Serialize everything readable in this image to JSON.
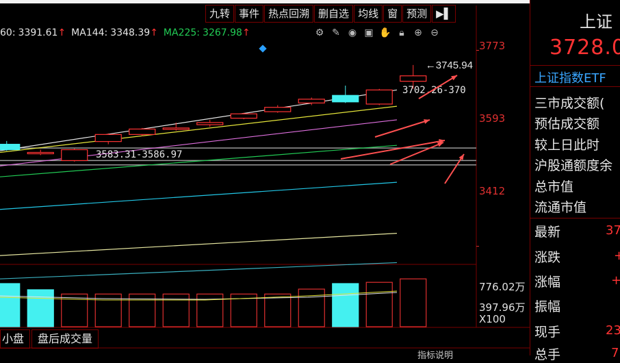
{
  "toolbar": {
    "items": [
      "九转",
      "事件",
      "热点回溯",
      "删自选",
      "均线",
      "窗",
      "预测",
      "▶▌"
    ]
  },
  "ma_legend": [
    {
      "label": "60:",
      "value": "3391.61",
      "arrow": "↑",
      "color": "#e6e6e6"
    },
    {
      "label": "MA144:",
      "value": "3348.39",
      "arrow": "↑",
      "color": "#e6e6e6"
    },
    {
      "label": "MA225:",
      "value": "3267.98",
      "arrow": "↑",
      "color": "#22cc55"
    }
  ],
  "toolbar_icons": [
    "gear-icon",
    "pen-icon",
    "eye-icon",
    "bag-icon",
    "hand-icon",
    "lock-icon",
    "zoom-in-icon",
    "zoom-out-icon"
  ],
  "price_axis": {
    "labels": [
      "3773",
      "3593",
      "3412"
    ],
    "color": "#e03030"
  },
  "volume_axis": {
    "labels": [
      "776.02万",
      "397.96万",
      "X100"
    ]
  },
  "annotations": {
    "high": "3745.94",
    "current_range": "3702.26-370",
    "gap_range": "3583.31-3586.97"
  },
  "bottom_tabs": [
    "小盘",
    "盘后成交量"
  ],
  "bottom_hint": "指标说明",
  "quote_panel": {
    "title": "上证",
    "price": "3728.0",
    "etf_label": "上证指数ETF",
    "items": [
      "三市成交额(",
      "预估成交额",
      "较上日此时",
      "沪股通额度余",
      "总市值",
      "流通市值"
    ],
    "stats": [
      {
        "label": "最新",
        "value": "37"
      },
      {
        "label": "涨跌",
        "value": "+"
      },
      {
        "label": "涨幅",
        "value": "+"
      },
      {
        "label": "振幅",
        "value": ""
      },
      {
        "label": "现手",
        "value": "23"
      },
      {
        "label": "总手",
        "value": "7"
      }
    ]
  },
  "chart_data": {
    "type": "candlestick",
    "price_range": [
      3380,
      3790
    ],
    "candles": [
      {
        "open": 3600,
        "close": 3590,
        "high": 3606,
        "low": 3588
      },
      {
        "open": 3585,
        "close": 3585,
        "high": 3590,
        "low": 3580
      },
      {
        "open": 3570,
        "close": 3590,
        "high": 3592,
        "low": 3568
      },
      {
        "open": 3605,
        "close": 3618,
        "high": 3620,
        "low": 3600
      },
      {
        "open": 3618,
        "close": 3628,
        "high": 3630,
        "low": 3615
      },
      {
        "open": 3628,
        "close": 3630,
        "high": 3640,
        "low": 3625
      },
      {
        "open": 3636,
        "close": 3640,
        "high": 3645,
        "low": 3632
      },
      {
        "open": 3648,
        "close": 3656,
        "high": 3658,
        "low": 3646
      },
      {
        "open": 3660,
        "close": 3668,
        "high": 3672,
        "low": 3658
      },
      {
        "open": 3676,
        "close": 3683,
        "high": 3686,
        "low": 3672
      },
      {
        "open": 3690,
        "close": 3678,
        "high": 3708,
        "low": 3676
      },
      {
        "open": 3674,
        "close": 3700,
        "high": 3702,
        "low": 3672
      },
      {
        "open": 3716,
        "close": 3726,
        "high": 3746,
        "low": 3702
      }
    ],
    "ma_lines": [
      {
        "color": "#e6e6e6",
        "from": 3588,
        "to": 3700
      },
      {
        "color": "#e6e63a",
        "from": 3585,
        "to": 3670
      },
      {
        "color": "#e070e0",
        "from": 3560,
        "to": 3645
      },
      {
        "color": "#22cc55",
        "from": 3540,
        "to": 3598
      },
      {
        "color": "#22c8e8",
        "from": 3480,
        "to": 3530
      },
      {
        "color": "#e6e6a0",
        "from": 3395,
        "to": 3436
      },
      {
        "color": "#3ab0c0",
        "from": 3352,
        "to": 3382
      }
    ],
    "volumes": [
      {
        "value": 700,
        "color": "#44f0f0"
      },
      {
        "value": 600,
        "color": "#44f0f0"
      },
      {
        "value": 530,
        "color": "#e03030"
      },
      {
        "value": 530,
        "color": "#e03030"
      },
      {
        "value": 530,
        "color": "#e03030"
      },
      {
        "value": 530,
        "color": "#e03030"
      },
      {
        "value": 530,
        "color": "#e03030"
      },
      {
        "value": 530,
        "color": "#e03030"
      },
      {
        "value": 530,
        "color": "#e03030"
      },
      {
        "value": 610,
        "color": "#e03030"
      },
      {
        "value": 700,
        "color": "#44f0f0"
      },
      {
        "value": 720,
        "color": "#e03030"
      },
      {
        "value": 776,
        "color": "#e03030"
      }
    ],
    "volume_range": [
      0,
      800
    ]
  }
}
